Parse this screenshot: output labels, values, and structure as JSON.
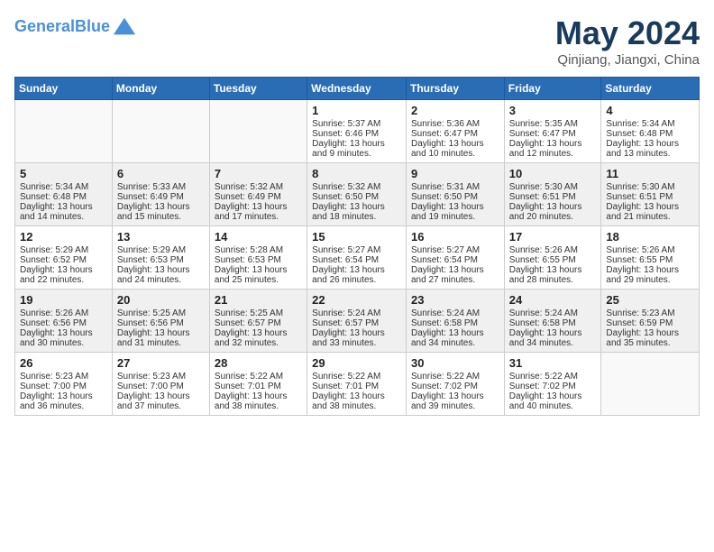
{
  "header": {
    "logo_line1": "General",
    "logo_line2": "Blue",
    "month_year": "May 2024",
    "location": "Qinjiang, Jiangxi, China"
  },
  "weekdays": [
    "Sunday",
    "Monday",
    "Tuesday",
    "Wednesday",
    "Thursday",
    "Friday",
    "Saturday"
  ],
  "weeks": [
    [
      {
        "day": "",
        "sunrise": "",
        "sunset": "",
        "daylight": ""
      },
      {
        "day": "",
        "sunrise": "",
        "sunset": "",
        "daylight": ""
      },
      {
        "day": "",
        "sunrise": "",
        "sunset": "",
        "daylight": ""
      },
      {
        "day": "1",
        "sunrise": "Sunrise: 5:37 AM",
        "sunset": "Sunset: 6:46 PM",
        "daylight": "Daylight: 13 hours and 9 minutes."
      },
      {
        "day": "2",
        "sunrise": "Sunrise: 5:36 AM",
        "sunset": "Sunset: 6:47 PM",
        "daylight": "Daylight: 13 hours and 10 minutes."
      },
      {
        "day": "3",
        "sunrise": "Sunrise: 5:35 AM",
        "sunset": "Sunset: 6:47 PM",
        "daylight": "Daylight: 13 hours and 12 minutes."
      },
      {
        "day": "4",
        "sunrise": "Sunrise: 5:34 AM",
        "sunset": "Sunset: 6:48 PM",
        "daylight": "Daylight: 13 hours and 13 minutes."
      }
    ],
    [
      {
        "day": "5",
        "sunrise": "Sunrise: 5:34 AM",
        "sunset": "Sunset: 6:48 PM",
        "daylight": "Daylight: 13 hours and 14 minutes."
      },
      {
        "day": "6",
        "sunrise": "Sunrise: 5:33 AM",
        "sunset": "Sunset: 6:49 PM",
        "daylight": "Daylight: 13 hours and 15 minutes."
      },
      {
        "day": "7",
        "sunrise": "Sunrise: 5:32 AM",
        "sunset": "Sunset: 6:49 PM",
        "daylight": "Daylight: 13 hours and 17 minutes."
      },
      {
        "day": "8",
        "sunrise": "Sunrise: 5:32 AM",
        "sunset": "Sunset: 6:50 PM",
        "daylight": "Daylight: 13 hours and 18 minutes."
      },
      {
        "day": "9",
        "sunrise": "Sunrise: 5:31 AM",
        "sunset": "Sunset: 6:50 PM",
        "daylight": "Daylight: 13 hours and 19 minutes."
      },
      {
        "day": "10",
        "sunrise": "Sunrise: 5:30 AM",
        "sunset": "Sunset: 6:51 PM",
        "daylight": "Daylight: 13 hours and 20 minutes."
      },
      {
        "day": "11",
        "sunrise": "Sunrise: 5:30 AM",
        "sunset": "Sunset: 6:51 PM",
        "daylight": "Daylight: 13 hours and 21 minutes."
      }
    ],
    [
      {
        "day": "12",
        "sunrise": "Sunrise: 5:29 AM",
        "sunset": "Sunset: 6:52 PM",
        "daylight": "Daylight: 13 hours and 22 minutes."
      },
      {
        "day": "13",
        "sunrise": "Sunrise: 5:29 AM",
        "sunset": "Sunset: 6:53 PM",
        "daylight": "Daylight: 13 hours and 24 minutes."
      },
      {
        "day": "14",
        "sunrise": "Sunrise: 5:28 AM",
        "sunset": "Sunset: 6:53 PM",
        "daylight": "Daylight: 13 hours and 25 minutes."
      },
      {
        "day": "15",
        "sunrise": "Sunrise: 5:27 AM",
        "sunset": "Sunset: 6:54 PM",
        "daylight": "Daylight: 13 hours and 26 minutes."
      },
      {
        "day": "16",
        "sunrise": "Sunrise: 5:27 AM",
        "sunset": "Sunset: 6:54 PM",
        "daylight": "Daylight: 13 hours and 27 minutes."
      },
      {
        "day": "17",
        "sunrise": "Sunrise: 5:26 AM",
        "sunset": "Sunset: 6:55 PM",
        "daylight": "Daylight: 13 hours and 28 minutes."
      },
      {
        "day": "18",
        "sunrise": "Sunrise: 5:26 AM",
        "sunset": "Sunset: 6:55 PM",
        "daylight": "Daylight: 13 hours and 29 minutes."
      }
    ],
    [
      {
        "day": "19",
        "sunrise": "Sunrise: 5:26 AM",
        "sunset": "Sunset: 6:56 PM",
        "daylight": "Daylight: 13 hours and 30 minutes."
      },
      {
        "day": "20",
        "sunrise": "Sunrise: 5:25 AM",
        "sunset": "Sunset: 6:56 PM",
        "daylight": "Daylight: 13 hours and 31 minutes."
      },
      {
        "day": "21",
        "sunrise": "Sunrise: 5:25 AM",
        "sunset": "Sunset: 6:57 PM",
        "daylight": "Daylight: 13 hours and 32 minutes."
      },
      {
        "day": "22",
        "sunrise": "Sunrise: 5:24 AM",
        "sunset": "Sunset: 6:57 PM",
        "daylight": "Daylight: 13 hours and 33 minutes."
      },
      {
        "day": "23",
        "sunrise": "Sunrise: 5:24 AM",
        "sunset": "Sunset: 6:58 PM",
        "daylight": "Daylight: 13 hours and 34 minutes."
      },
      {
        "day": "24",
        "sunrise": "Sunrise: 5:24 AM",
        "sunset": "Sunset: 6:58 PM",
        "daylight": "Daylight: 13 hours and 34 minutes."
      },
      {
        "day": "25",
        "sunrise": "Sunrise: 5:23 AM",
        "sunset": "Sunset: 6:59 PM",
        "daylight": "Daylight: 13 hours and 35 minutes."
      }
    ],
    [
      {
        "day": "26",
        "sunrise": "Sunrise: 5:23 AM",
        "sunset": "Sunset: 7:00 PM",
        "daylight": "Daylight: 13 hours and 36 minutes."
      },
      {
        "day": "27",
        "sunrise": "Sunrise: 5:23 AM",
        "sunset": "Sunset: 7:00 PM",
        "daylight": "Daylight: 13 hours and 37 minutes."
      },
      {
        "day": "28",
        "sunrise": "Sunrise: 5:22 AM",
        "sunset": "Sunset: 7:01 PM",
        "daylight": "Daylight: 13 hours and 38 minutes."
      },
      {
        "day": "29",
        "sunrise": "Sunrise: 5:22 AM",
        "sunset": "Sunset: 7:01 PM",
        "daylight": "Daylight: 13 hours and 38 minutes."
      },
      {
        "day": "30",
        "sunrise": "Sunrise: 5:22 AM",
        "sunset": "Sunset: 7:02 PM",
        "daylight": "Daylight: 13 hours and 39 minutes."
      },
      {
        "day": "31",
        "sunrise": "Sunrise: 5:22 AM",
        "sunset": "Sunset: 7:02 PM",
        "daylight": "Daylight: 13 hours and 40 minutes."
      },
      {
        "day": "",
        "sunrise": "",
        "sunset": "",
        "daylight": ""
      }
    ]
  ]
}
